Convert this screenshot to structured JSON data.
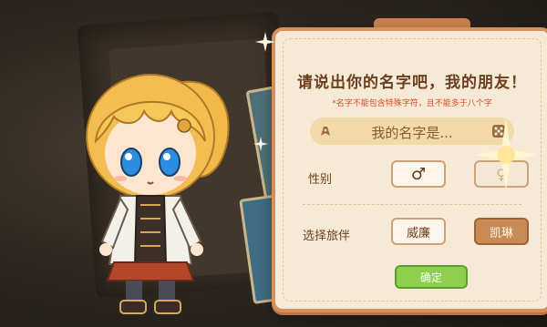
{
  "panel": {
    "title": "请说出你的名字吧，我的朋友！",
    "hint": "*名字不能包含特殊字符，且不能多于八个字",
    "name_placeholder": "我的名字是...",
    "gender_label": "性别",
    "gender_male_symbol": "♂",
    "partner_label": "选择旅伴",
    "partners": [
      "威廉",
      "凯琳"
    ],
    "selected_partner": "凯琳",
    "confirm_label": "确定"
  },
  "colors": {
    "panel_bg": "#f6ead7",
    "panel_border": "#d8905a",
    "accent": "#c98a55",
    "confirm": "#8cd04e",
    "hint": "#e04a2a"
  },
  "icons": [
    "pen-icon",
    "dice-icon",
    "male-icon",
    "sparkle-icon"
  ]
}
